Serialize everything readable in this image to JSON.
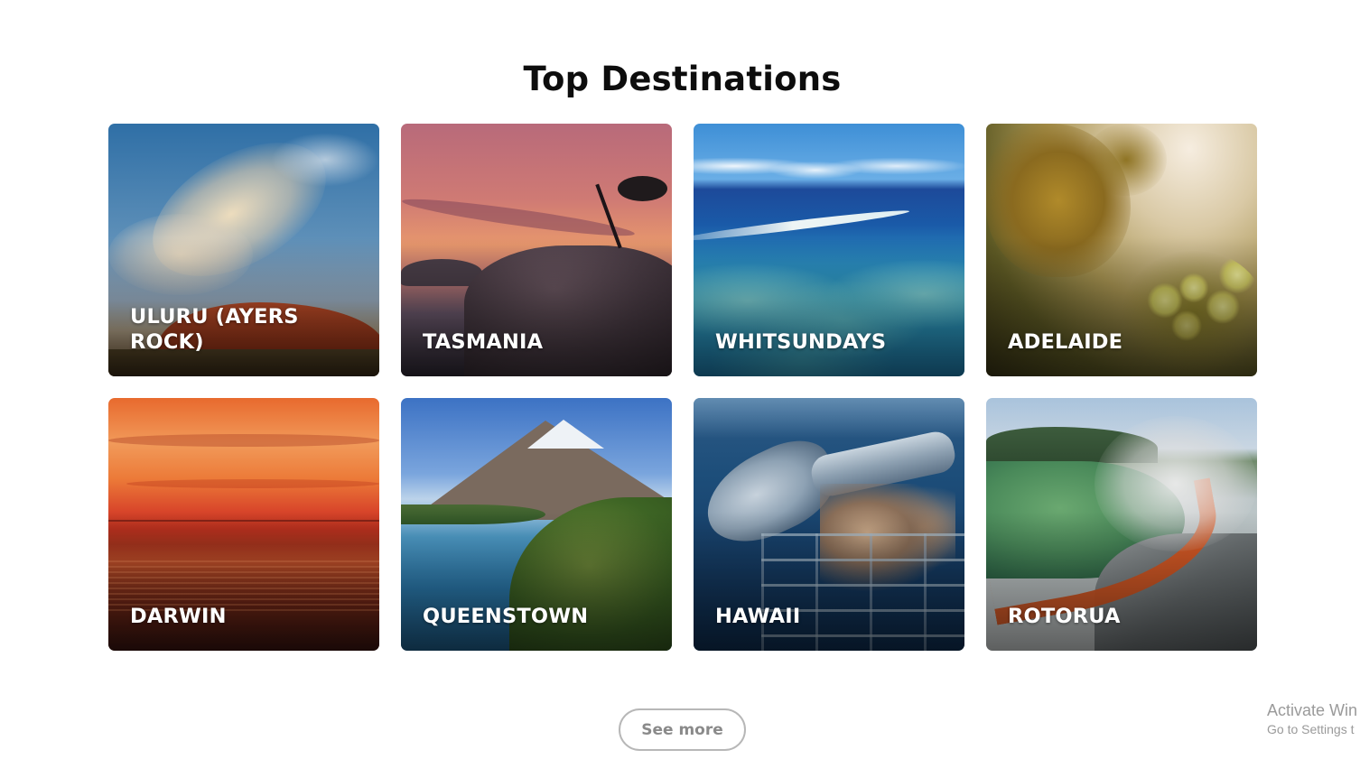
{
  "section": {
    "title": "Top Destinations"
  },
  "destinations": [
    {
      "name": "ULURU (AYERS ROCK)"
    },
    {
      "name": "TASMANIA"
    },
    {
      "name": "WHITSUNDAYS"
    },
    {
      "name": "ADELAIDE"
    },
    {
      "name": "DARWIN"
    },
    {
      "name": "QUEENSTOWN"
    },
    {
      "name": "HAWAII"
    },
    {
      "name": "ROTORUA"
    }
  ],
  "actions": {
    "see_more_label": "See more"
  },
  "watermark": {
    "title": "Activate Win",
    "subtitle": "Go to Settings t"
  }
}
